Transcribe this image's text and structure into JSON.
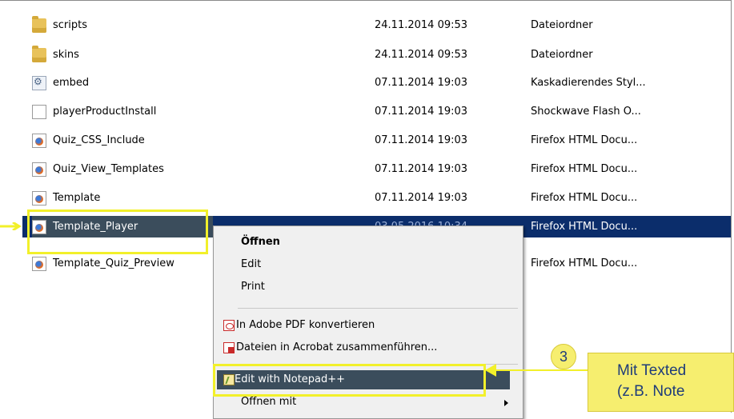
{
  "files": [
    {
      "name": "scripts",
      "date": "24.11.2014 09:53",
      "type": "Dateiordner",
      "icon": "folder-icon"
    },
    {
      "name": "skins",
      "date": "24.11.2014 09:53",
      "type": "Dateiordner",
      "icon": "folder-icon"
    },
    {
      "name": "embed",
      "date": "07.11.2014 19:03",
      "type": "Kaskadierendes Styl...",
      "icon": "css-file-icon"
    },
    {
      "name": "playerProductInstall",
      "date": "07.11.2014 19:03",
      "type": "Shockwave Flash O...",
      "icon": "file-icon"
    },
    {
      "name": "Quiz_CSS_Include",
      "date": "07.11.2014 19:03",
      "type": "Firefox HTML Docu...",
      "icon": "firefox-file-icon"
    },
    {
      "name": "Quiz_View_Templates",
      "date": "07.11.2014 19:03",
      "type": "Firefox HTML Docu...",
      "icon": "firefox-file-icon"
    },
    {
      "name": "Template",
      "date": "07.11.2014 19:03",
      "type": "Firefox HTML Docu...",
      "icon": "firefox-file-icon"
    },
    {
      "name": "Template_Player",
      "date": "03.05.2016 10:34",
      "type": "Firefox HTML Docu...",
      "icon": "firefox-file-icon"
    },
    {
      "name": "Template_Quiz_Preview",
      "date": "",
      "type": "Firefox HTML Docu...",
      "icon": "firefox-file-icon"
    }
  ],
  "context_menu": {
    "open": "Öffnen",
    "edit": "Edit",
    "print": "Print",
    "pdf_convert": "In Adobe PDF konvertieren",
    "acrobat_merge": "Dateien in Acrobat zusammenführen...",
    "notepadpp": "Edit with Notepad++",
    "open_with": "Öffnen mit"
  },
  "callout": {
    "step": "3",
    "line1": "Mit Texted",
    "line2": "(z.B. Note"
  },
  "colors": {
    "selection": "#0b2d6b",
    "highlight_border": "#f2f02a",
    "callout_bg": "#f6ee6f",
    "callout_text": "#1f3c7a"
  }
}
